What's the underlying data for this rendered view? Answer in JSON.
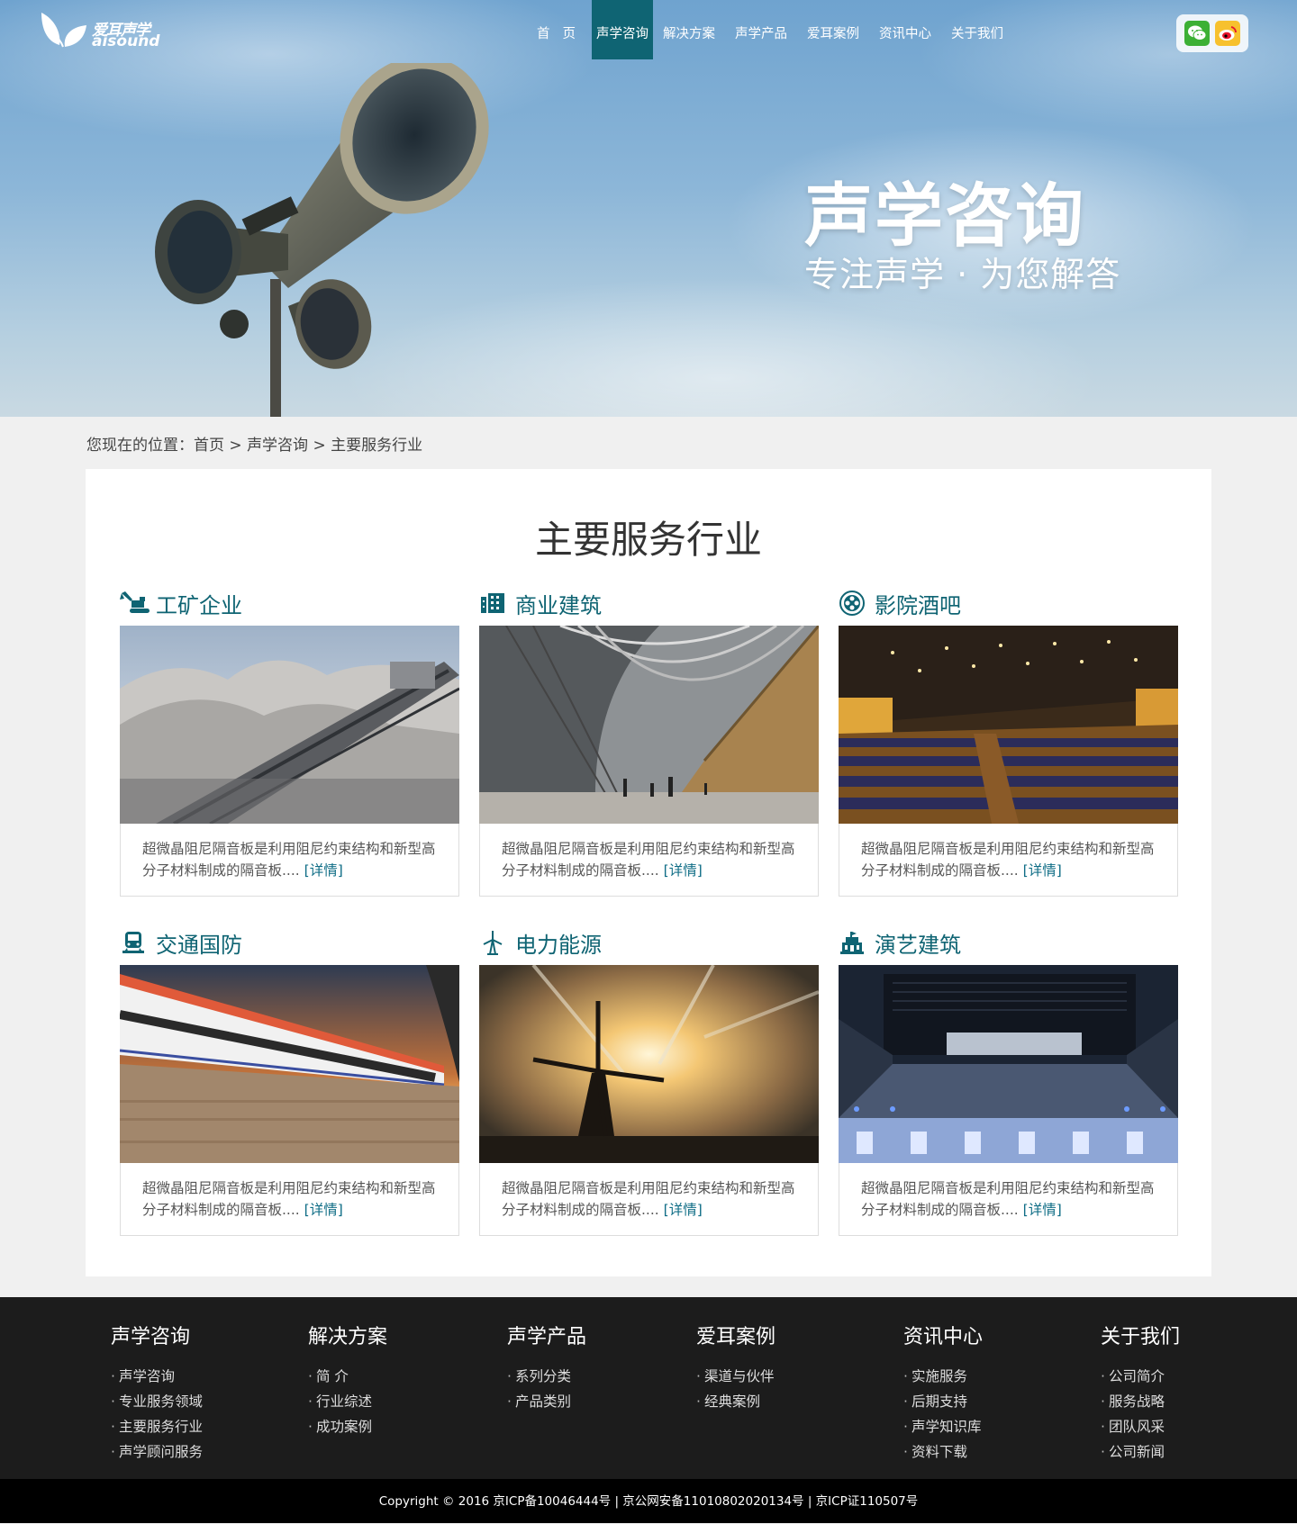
{
  "logo": {
    "cn": "爱耳声学",
    "en": "aisound"
  },
  "nav": [
    {
      "label": "首页",
      "active": false
    },
    {
      "label": "声学咨询",
      "active": true
    },
    {
      "label": "解决方案",
      "active": false
    },
    {
      "label": "声学产品",
      "active": false
    },
    {
      "label": "爱耳案例",
      "active": false
    },
    {
      "label": "资讯中心",
      "active": false
    },
    {
      "label": "关于我们",
      "active": false
    }
  ],
  "social": {
    "wechat_icon": "wechat-icon",
    "weibo_icon": "weibo-icon"
  },
  "hero": {
    "title": "声学咨询",
    "subtitle": "专注声学 · 为您解答"
  },
  "breadcrumb": {
    "prefix": "您现在的位置：",
    "items": [
      "首页",
      "声学咨询",
      "主要服务行业"
    ],
    "separator": ">"
  },
  "section_title": "主要服务行业",
  "industries": [
    {
      "name": "工矿企业",
      "icon": "excavator-icon",
      "desc": "超微晶阻尼隔音板是利用阻尼约束结构和新型高分子材料制成的隔音板....",
      "more": "[详情]"
    },
    {
      "name": "商业建筑",
      "icon": "building-icon",
      "desc": "超微晶阻尼隔音板是利用阻尼约束结构和新型高分子材料制成的隔音板....",
      "more": "[详情]"
    },
    {
      "name": "影院酒吧",
      "icon": "film-reel-icon",
      "desc": "超微晶阻尼隔音板是利用阻尼约束结构和新型高分子材料制成的隔音板....",
      "more": "[详情]"
    },
    {
      "name": "交通国防",
      "icon": "train-icon",
      "desc": "超微晶阻尼隔音板是利用阻尼约束结构和新型高分子材料制成的隔音板....",
      "more": "[详情]"
    },
    {
      "name": "电力能源",
      "icon": "wind-turbine-icon",
      "desc": "超微晶阻尼隔音板是利用阻尼约束结构和新型高分子材料制成的隔音板....",
      "more": "[详情]"
    },
    {
      "name": "演艺建筑",
      "icon": "theater-icon",
      "desc": "超微晶阻尼隔音板是利用阻尼约束结构和新型高分子材料制成的隔音板....",
      "more": "[详情]"
    }
  ],
  "footer": [
    {
      "title": "声学咨询",
      "links": [
        "声学咨询",
        "专业服务领域",
        "主要服务行业",
        "声学顾问服务"
      ]
    },
    {
      "title": "解决方案",
      "links": [
        "简 介",
        "行业综述",
        "成功案例"
      ]
    },
    {
      "title": "声学产品",
      "links": [
        "系列分类",
        "产品类别"
      ]
    },
    {
      "title": "爱耳案例",
      "links": [
        "渠道与伙伴",
        "经典案例"
      ]
    },
    {
      "title": "资讯中心",
      "links": [
        "实施服务",
        "后期支持",
        "声学知识库",
        "资料下载"
      ]
    },
    {
      "title": "关于我们",
      "links": [
        "公司简介",
        "服务战略",
        "团队风采",
        "公司新闻"
      ]
    }
  ],
  "copyright": "Copyright © 2016  京ICP备10046444号 | 京公网安备11010802020134号 | 京ICP证110507号",
  "colors": {
    "accent": "#0f6473",
    "link": "#0f6d86",
    "footer_bg": "#1c1c1c",
    "copyright_bg": "#000000"
  }
}
